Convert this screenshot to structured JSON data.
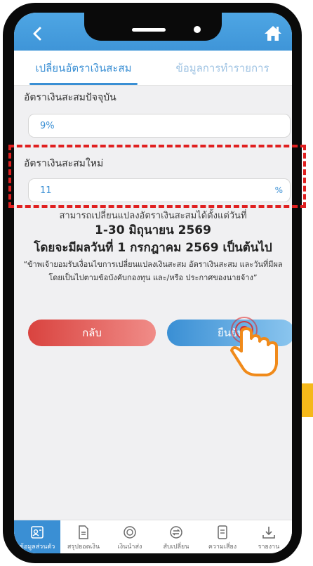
{
  "tabs": [
    {
      "label": "เปลี่ยนอัตราเงินสะสม"
    },
    {
      "label": "ข้อมูลการทำรายการ"
    }
  ],
  "current_rate": {
    "label": "อัตราเงินสะสมปัจจุบัน",
    "value": "9%"
  },
  "new_rate": {
    "label": "อัตราเงินสะสมใหม่",
    "value": "11",
    "unit": "%"
  },
  "info": {
    "line1": "สามารถเปลี่ยนแปลงอัตราเงินสะสมได้ตั้งแต่วันที่",
    "line2": "1-30 มิถุนายน 2569",
    "line3": "โดยจะมีผลวันที่ 1 กรกฎาคม 2569 เป็นต้นไป",
    "disclaimer": "“ข้าพเจ้ายอมรับเงื่อนไขการเปลี่ยนแปลงเงินสะสม อัตราเงินสะสม และวันที่มีผลโดยเป็นไปตามข้อบังคับกองทุน และ/หรือ ประกาศของนายจ้าง”"
  },
  "buttons": {
    "back": "กลับ",
    "confirm": "ยืนยัน"
  },
  "nav": [
    {
      "label": "ข้อมูลส่วนตัว",
      "icon": "profile-icon"
    },
    {
      "label": "สรุปยอดเงิน",
      "icon": "document-icon"
    },
    {
      "label": "เงินนำส่ง",
      "icon": "contribution-icon"
    },
    {
      "label": "สับเปลี่ยน",
      "icon": "switch-icon"
    },
    {
      "label": "ความเสี่ยง",
      "icon": "risk-icon"
    },
    {
      "label": "รายงาน",
      "icon": "download-icon"
    }
  ],
  "colors": {
    "accent": "#3a8fd4",
    "back_button": "#d9433f",
    "highlight": "#e02020",
    "side_tab": "#f5b81a"
  }
}
